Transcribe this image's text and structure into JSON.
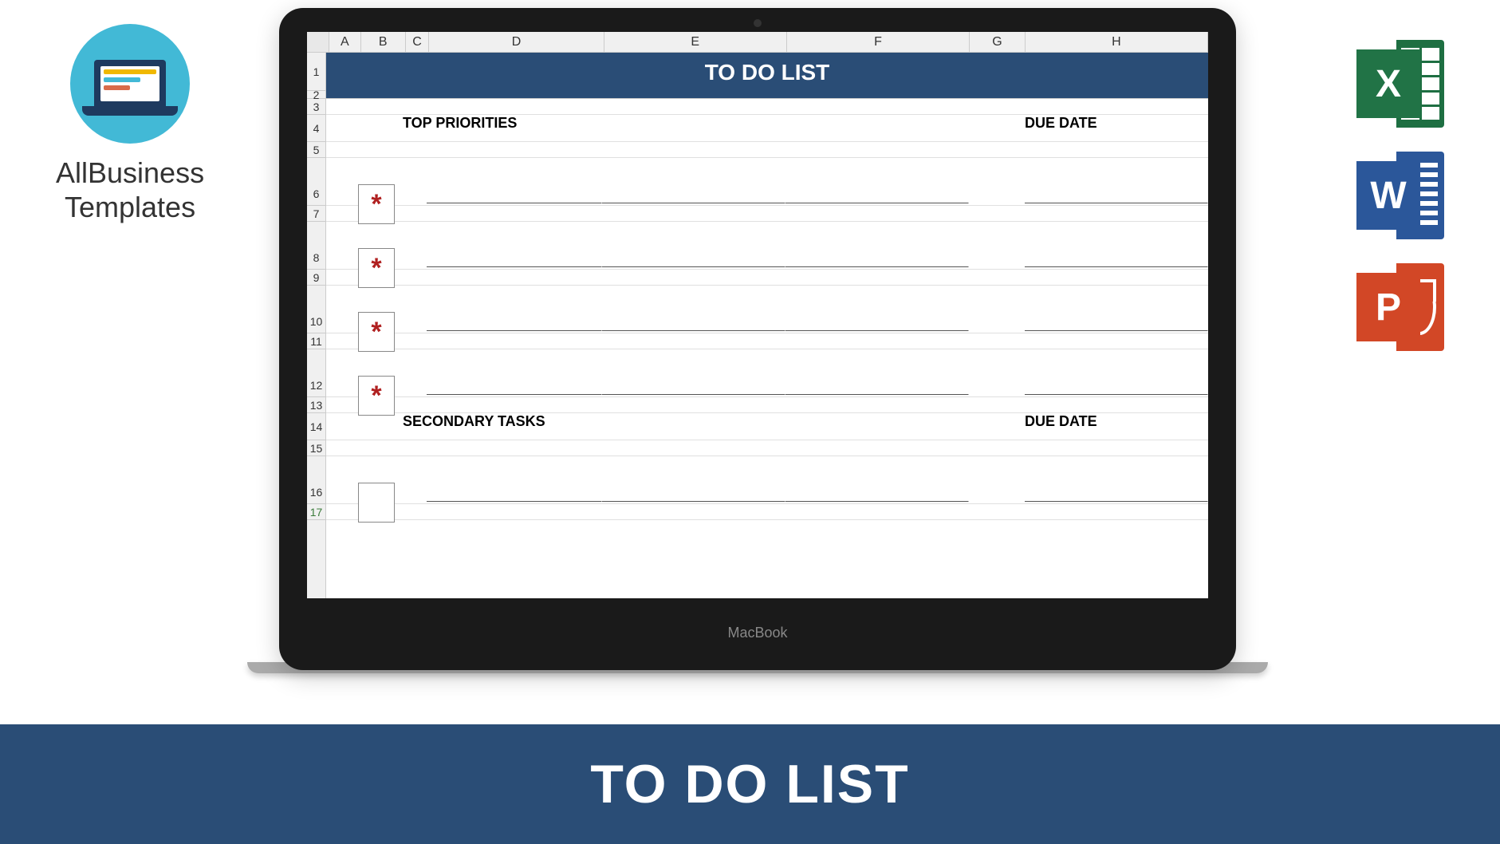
{
  "brand": {
    "name_line1": "AllBusiness",
    "name_line2": "Templates"
  },
  "apps": {
    "excel_letter": "X",
    "word_letter": "W",
    "ppt_letter": "P"
  },
  "laptop": {
    "label": "MacBook"
  },
  "spreadsheet": {
    "columns": [
      "A",
      "B",
      "C",
      "D",
      "E",
      "F",
      "G",
      "H"
    ],
    "rows": [
      "1",
      "2",
      "3",
      "4",
      "5",
      "6",
      "7",
      "8",
      "9",
      "10",
      "11",
      "12",
      "13",
      "14",
      "15",
      "16",
      "17"
    ],
    "title": "TO DO LIST",
    "section1": "TOP PRIORITIES",
    "section2": "SECONDARY TASKS",
    "due_label": "DUE DATE",
    "priority_marker": "*"
  },
  "banner": {
    "text": "TO DO LIST"
  }
}
